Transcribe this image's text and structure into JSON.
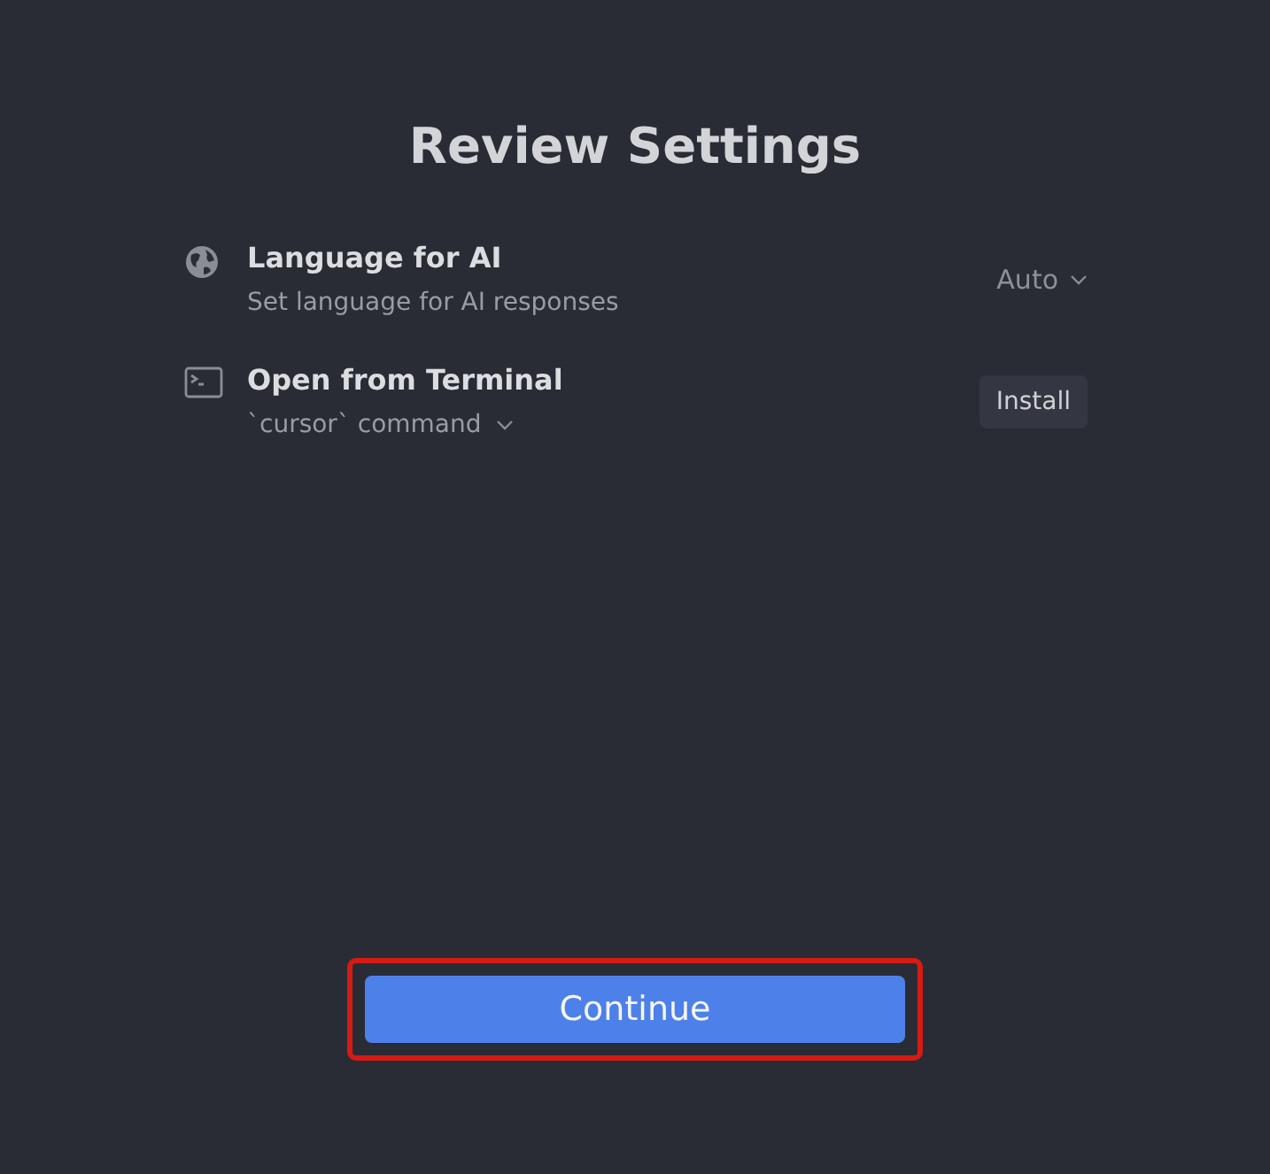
{
  "title": "Review Settings",
  "settings": [
    {
      "label": "Language for AI",
      "description": "Set language for AI responses",
      "expandable": false,
      "kind": "select",
      "value": "Auto"
    },
    {
      "label": "Open from Terminal",
      "description": "`cursor` command",
      "expandable": true,
      "kind": "button",
      "value": "Install"
    }
  ],
  "continue_button": {
    "label": "Continue",
    "highlighted": true
  }
}
